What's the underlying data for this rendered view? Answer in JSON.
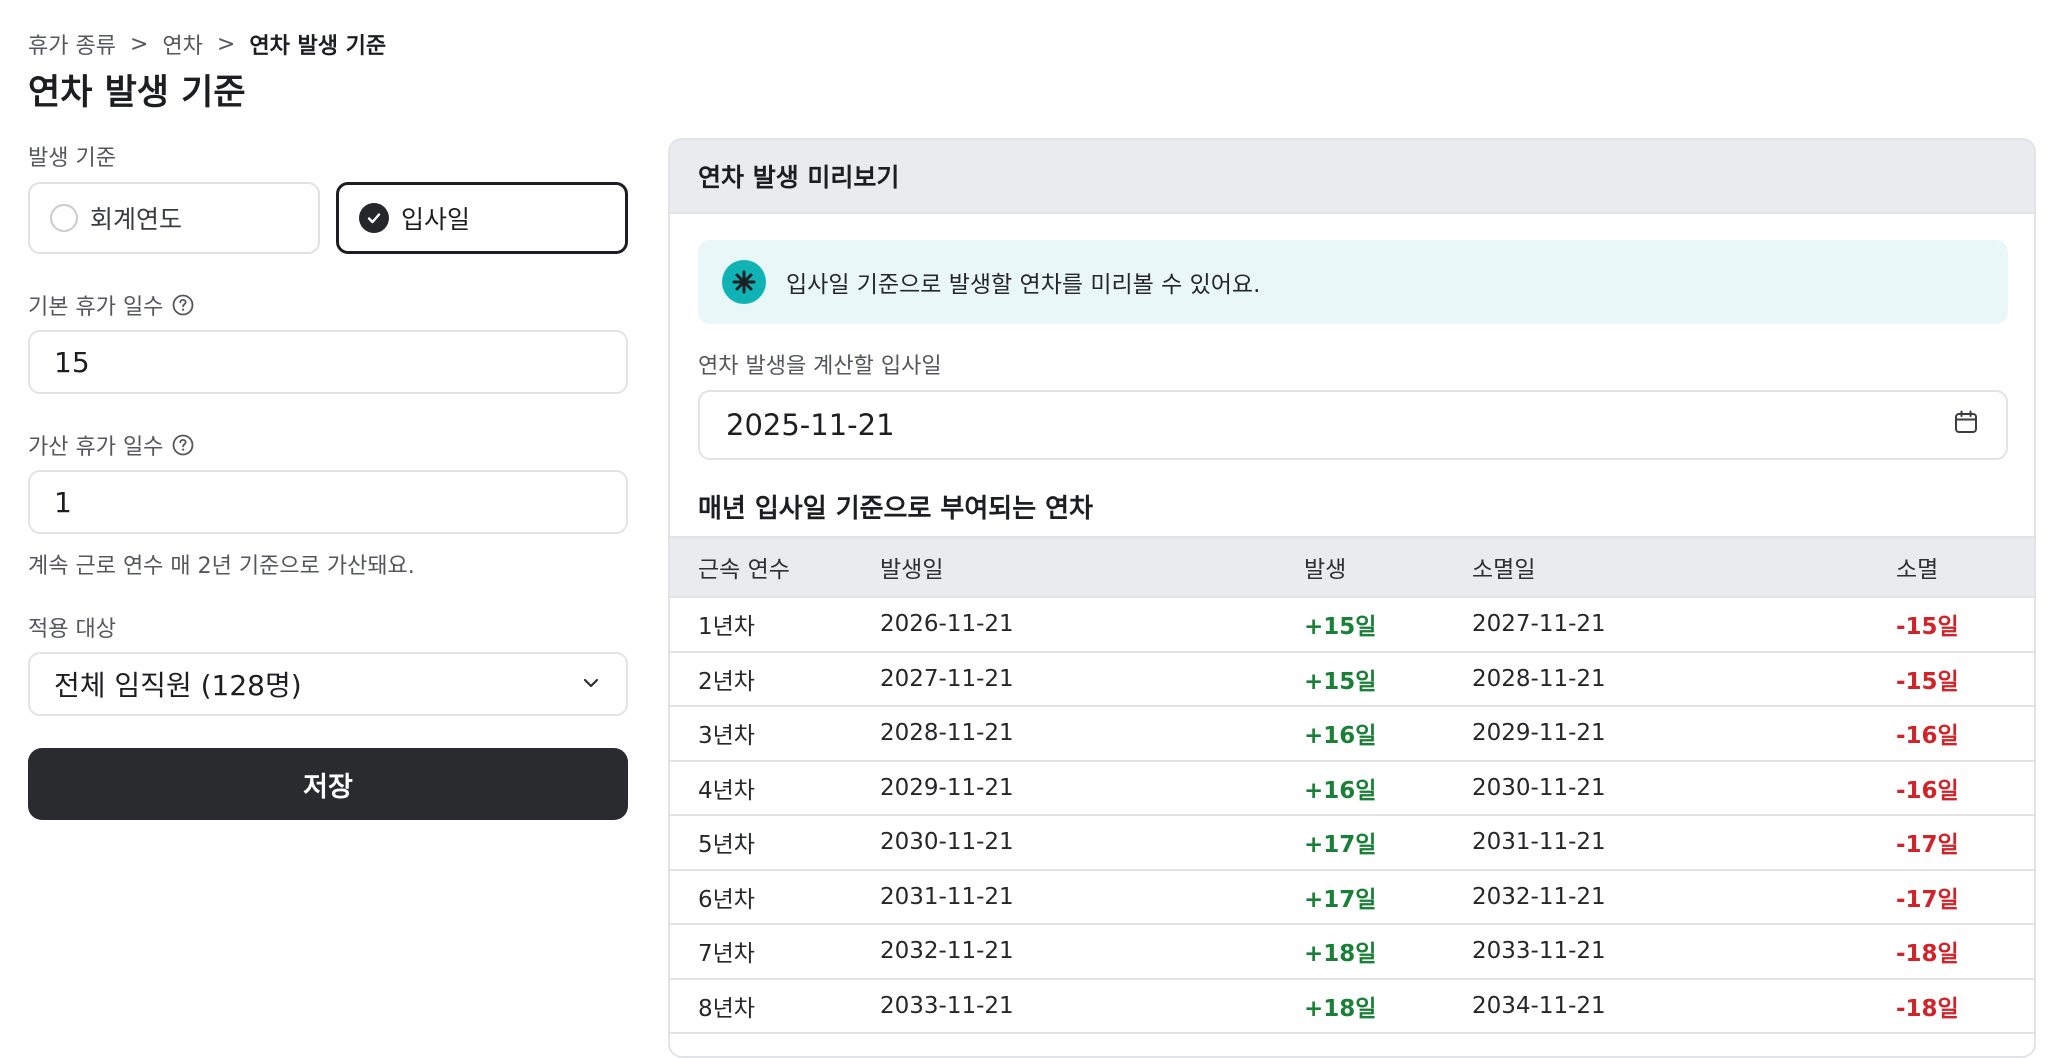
{
  "breadcrumb": {
    "items": [
      "휴가 종류",
      "연차"
    ],
    "separator": ">",
    "current": "연차 발생 기준"
  },
  "page_title": "연차 발생 기준",
  "form": {
    "basis_label": "발생 기준",
    "basis_options": [
      {
        "label": "회계연도",
        "selected": false
      },
      {
        "label": "입사일",
        "selected": true
      }
    ],
    "base_days_label": "기본 휴가 일수",
    "base_days_value": "15",
    "extra_days_label": "가산 휴가 일수",
    "extra_days_value": "1",
    "extra_hint": "계속 근로 연수 매 2년 기준으로 가산돼요.",
    "target_label": "적용 대상",
    "target_value": "전체 임직원 (128명)",
    "save_label": "저장"
  },
  "preview": {
    "title": "연차 발생 미리보기",
    "info_text": "입사일 기준으로 발생할 연차를 미리볼 수 있어요.",
    "date_label": "연차 발생을 계산할 입사일",
    "date_value": "2025-11-21",
    "section_title": "매년 입사일 기준으로 부여되는 연차",
    "columns": [
      "근속 연수",
      "발생일",
      "발생",
      "소멸일",
      "소멸"
    ],
    "rows": [
      [
        "1년차",
        "2026-11-21",
        "+15일",
        "2027-11-21",
        "-15일"
      ],
      [
        "2년차",
        "2027-11-21",
        "+15일",
        "2028-11-21",
        "-15일"
      ],
      [
        "3년차",
        "2028-11-21",
        "+16일",
        "2029-11-21",
        "-16일"
      ],
      [
        "4년차",
        "2029-11-21",
        "+16일",
        "2030-11-21",
        "-16일"
      ],
      [
        "5년차",
        "2030-11-21",
        "+17일",
        "2031-11-21",
        "-17일"
      ],
      [
        "6년차",
        "2031-11-21",
        "+17일",
        "2032-11-21",
        "-17일"
      ],
      [
        "7년차",
        "2032-11-21",
        "+18일",
        "2033-11-21",
        "-18일"
      ],
      [
        "8년차",
        "2033-11-21",
        "+18일",
        "2034-11-21",
        "-18일"
      ]
    ]
  },
  "colors": {
    "accent_teal": "#0fb3b5",
    "positive": "#1a7f37",
    "negative": "#d0242b",
    "button": "#2a2b2f"
  }
}
